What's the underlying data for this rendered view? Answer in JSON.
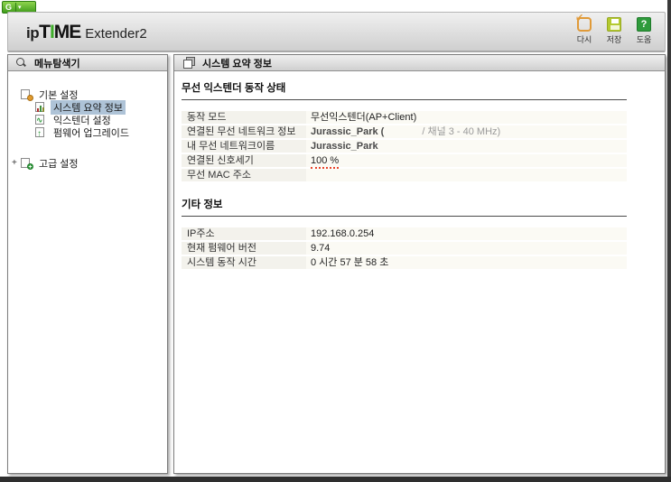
{
  "browser": {
    "extension_button": {
      "label": "G",
      "chevron": "▾"
    }
  },
  "header": {
    "logo": {
      "ip": "ip",
      "t": "T",
      "i": "I",
      "me": "ME",
      "product": "Extender2"
    },
    "toolbar": {
      "refresh_label": "다시",
      "save_label": "저장",
      "help_label": "도움",
      "help_glyph": "?"
    },
    "colors": {
      "brand_green": "#3fae2a",
      "refresh_orange": "#e09a38",
      "save_yellowgreen": "#b4c930",
      "help_green": "#2f9b3c"
    }
  },
  "sidebar": {
    "title": "메뉴탐색기",
    "tree": [
      {
        "label": "기본 설정",
        "icon": "folder-gear-icon",
        "selected": false
      },
      {
        "label": "시스템 요약 정보",
        "icon": "chart-icon",
        "selected": true
      },
      {
        "label": "익스텐더 설정",
        "icon": "extender-icon",
        "selected": false
      },
      {
        "label": "펌웨어 업그레이드",
        "icon": "firmware-up-icon",
        "selected": false
      },
      {
        "label": "고급 설정",
        "icon": "folder-plus-icon",
        "selected": false,
        "expander": "+"
      }
    ]
  },
  "main": {
    "title": "시스템 요약 정보",
    "sections": [
      {
        "title": "무선 익스텐더 동작 상태",
        "rows": [
          {
            "label": "동작 모드",
            "value": "무선익스텐더(AP+Client)"
          },
          {
            "label": "연결된 무선 네트워크 정보",
            "value": "Jurassic_Park (",
            "value_suffix": "/ 채널 3 - 40 MHz)"
          },
          {
            "label": "내 무선 네트워크이름",
            "value": "Jurassic_Park"
          },
          {
            "label": "연결된 신호세기",
            "value": "100 %"
          },
          {
            "label": "무선 MAC 주소",
            "value": ""
          }
        ]
      },
      {
        "title": "기타 정보",
        "rows": [
          {
            "label": "IP주소",
            "value": "192.168.0.254"
          },
          {
            "label": "현재 펌웨어 버전",
            "value": "9.74"
          },
          {
            "label": "시스템 동작 시간",
            "value": "0 시간 57 분 58 초"
          }
        ]
      }
    ]
  }
}
